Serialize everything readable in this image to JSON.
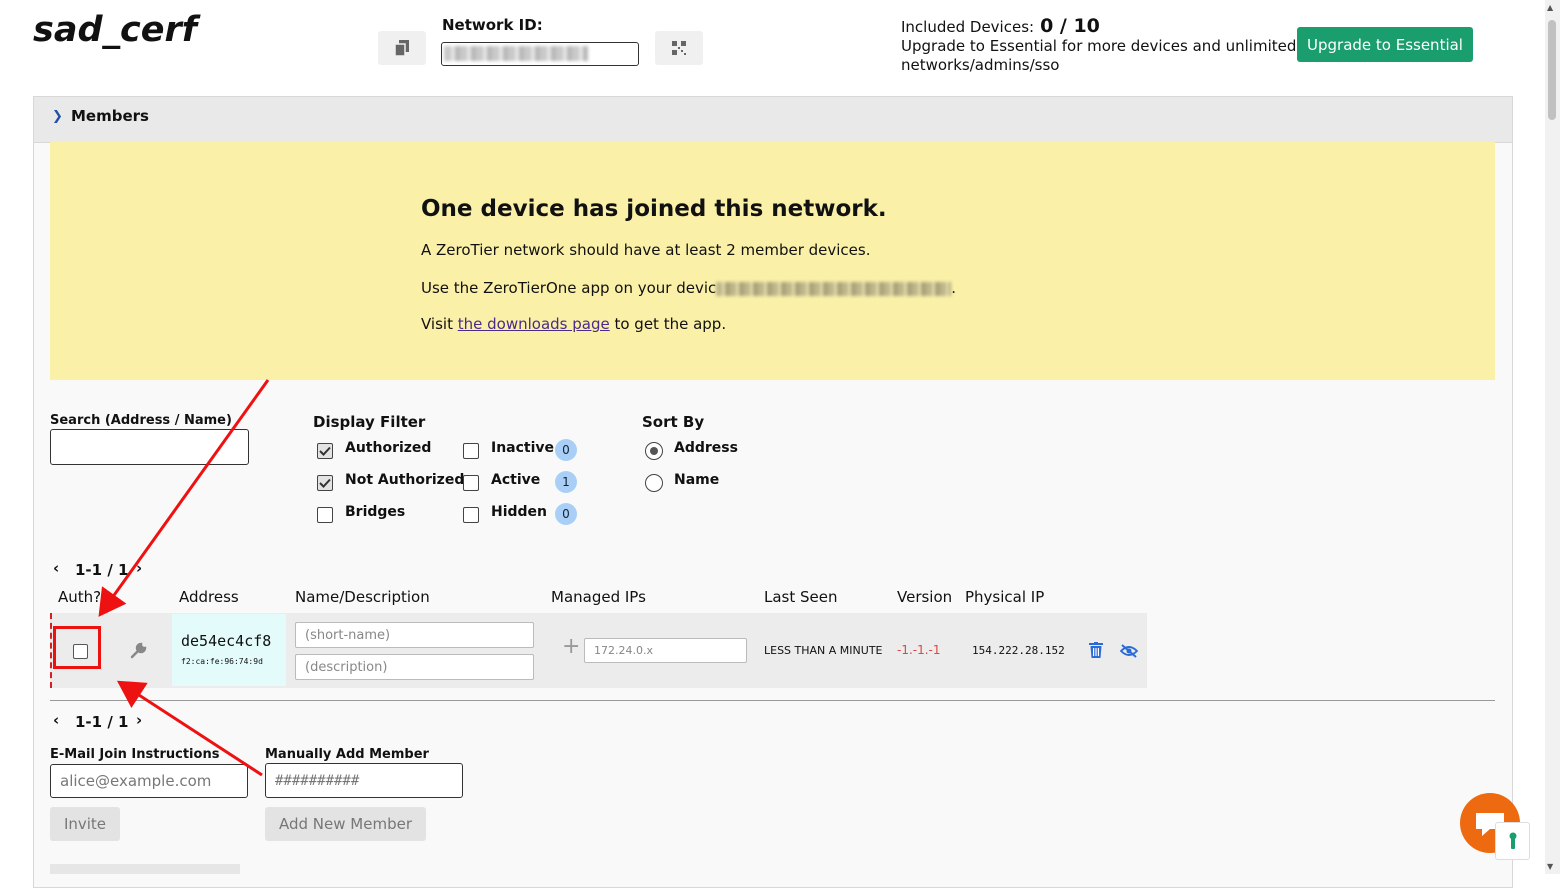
{
  "header": {
    "network_name": "sad_cerf",
    "network_id_label": "Network ID:",
    "included_label": "Included Devices:",
    "included_count": "0 / 10",
    "upgrade_line1": "Upgrade to Essential for more devices and unlimited",
    "upgrade_line2": "networks/admins/sso",
    "upgrade_button": "Upgrade to Essential"
  },
  "members": {
    "section_title": "Members",
    "banner": {
      "title": "One device has joined this network.",
      "line1": "A ZeroTier network should have at least 2 member devices.",
      "line2_prefix": "Use the ZeroTierOne app on your devic",
      "line2_suffix": ".",
      "line3_prefix": "Visit ",
      "line3_link": "the downloads page",
      "line3_suffix": " to get the app."
    },
    "search_label": "Search (Address / Name)",
    "display_filter": {
      "title": "Display Filter",
      "authorized": "Authorized",
      "not_authorized": "Not Authorized",
      "bridges": "Bridges",
      "inactive": "Inactive",
      "active": "Active",
      "hidden": "Hidden",
      "inactive_count": "0",
      "active_count": "1",
      "hidden_count": "0"
    },
    "sort_by": {
      "title": "Sort By",
      "address": "Address",
      "name": "Name"
    },
    "pager_text": "1-1 / 1",
    "columns": {
      "auth": "Auth?",
      "address": "Address",
      "name": "Name/Description",
      "managed_ips": "Managed IPs",
      "last_seen": "Last Seen",
      "version": "Version",
      "physical_ip": "Physical IP"
    },
    "row": {
      "address": "de54ec4cf8",
      "mac": "f2:ca:fe:96:74:9d",
      "short_name_placeholder": "(short-name)",
      "description_placeholder": "(description)",
      "ip_placeholder": "172.24.0.x",
      "last_seen": "LESS THAN A MINUTE",
      "version": "-1.-1.-1",
      "physical_ip": "154.222.28.152"
    },
    "email_label": "E-Mail Join Instructions",
    "email_placeholder": "alice@example.com",
    "manual_label": "Manually Add Member",
    "manual_placeholder": "##########",
    "invite_button": "Invite",
    "add_member_button": "Add New Member"
  },
  "colors": {
    "accent_green": "#1a9e6e",
    "banner_yellow": "#faf0a8",
    "annotation_red": "#ee1111",
    "icon_blue": "#2a6bd8"
  }
}
